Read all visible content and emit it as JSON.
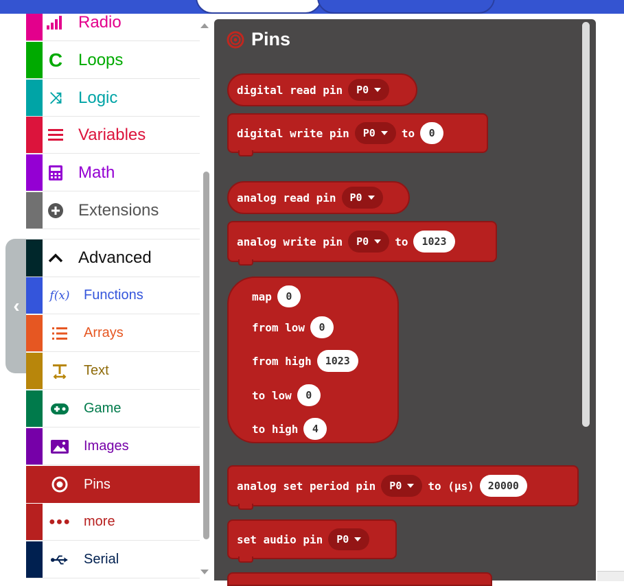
{
  "sidebar": {
    "categories": [
      {
        "label": "Radio",
        "icon": "radio-signal-icon",
        "color": "#e3008c"
      },
      {
        "label": "Loops",
        "icon": "loop-icon",
        "color": "#00aa00"
      },
      {
        "label": "Logic",
        "icon": "shuffle-icon",
        "color": "#00a4a6"
      },
      {
        "label": "Variables",
        "icon": "list-icon",
        "color": "#dc143c"
      },
      {
        "label": "Math",
        "icon": "calculator-icon",
        "color": "#9400d3"
      },
      {
        "label": "Extensions",
        "icon": "plus-circle-icon",
        "color": "#717171"
      },
      {
        "label": "Advanced",
        "icon": "chevron-up-icon",
        "color": "#00272b"
      },
      {
        "label": "Functions",
        "icon": "function-icon",
        "color": "#3455db"
      },
      {
        "label": "Arrays",
        "icon": "numbered-list-icon",
        "color": "#e65722"
      },
      {
        "label": "Text",
        "icon": "text-icon",
        "color": "#b8860b"
      },
      {
        "label": "Game",
        "icon": "gamepad-icon",
        "color": "#007a4b"
      },
      {
        "label": "Images",
        "icon": "image-icon",
        "color": "#7600a8"
      },
      {
        "label": "Pins",
        "icon": "target-icon",
        "color": "#b22222"
      },
      {
        "label": "more",
        "icon": "ellipsis-icon",
        "color": "#b22222"
      },
      {
        "label": "Serial",
        "icon": "usb-icon",
        "color": "#002050"
      }
    ]
  },
  "flyout": {
    "title": "Pins",
    "blocks": {
      "digital_read": {
        "label": "digital read pin",
        "pin": "P0"
      },
      "digital_write": {
        "label": "digital write pin",
        "pin": "P0",
        "to": "to",
        "value": "0"
      },
      "analog_read": {
        "label": "analog read pin",
        "pin": "P0"
      },
      "analog_write": {
        "label": "analog write pin",
        "pin": "P0",
        "to": "to",
        "value": "1023"
      },
      "map": {
        "map_label": "map",
        "map_value": "0",
        "from_low_label": "from low",
        "from_low_value": "0",
        "from_high_label": "from high",
        "from_high_value": "1023",
        "to_low_label": "to low",
        "to_low_value": "0",
        "to_high_label": "to high",
        "to_high_value": "4"
      },
      "analog_set_period": {
        "label": "analog set period pin",
        "pin": "P0",
        "to": "to (µs)",
        "value": "20000"
      },
      "set_audio": {
        "label": "set audio pin",
        "pin": "P0"
      }
    }
  },
  "colors": {
    "pins_block": "#b7201f",
    "flyout_bg": "#4a4848",
    "topbar": "#3454d1"
  }
}
